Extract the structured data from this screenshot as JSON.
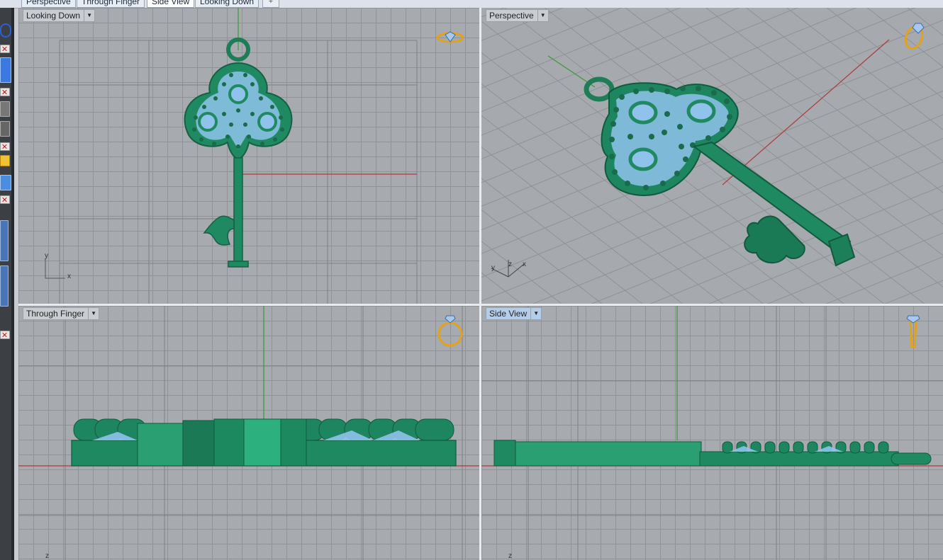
{
  "tabs": [
    "Perspective",
    "Through Finger",
    "Side View",
    "Looking Down"
  ],
  "active_tab": "Side View",
  "viewports": {
    "top_left": {
      "label": "Looking Down"
    },
    "top_right": {
      "label": "Perspective"
    },
    "bottom_left": {
      "label": "Through Finger"
    },
    "bottom_right": {
      "label": "Side View"
    }
  },
  "axes": {
    "top_left_y": "y",
    "top_left_x": "x",
    "persp_y": "y",
    "persp_z": "z",
    "persp_x": "x",
    "bl_z": "z",
    "br_z": "z"
  },
  "colors": {
    "model": "#1e8a62",
    "gem": "#9ecbf2",
    "x_axis": "#b03a3a",
    "y_axis": "#3a9a3a",
    "widget": "#e2a21a"
  }
}
